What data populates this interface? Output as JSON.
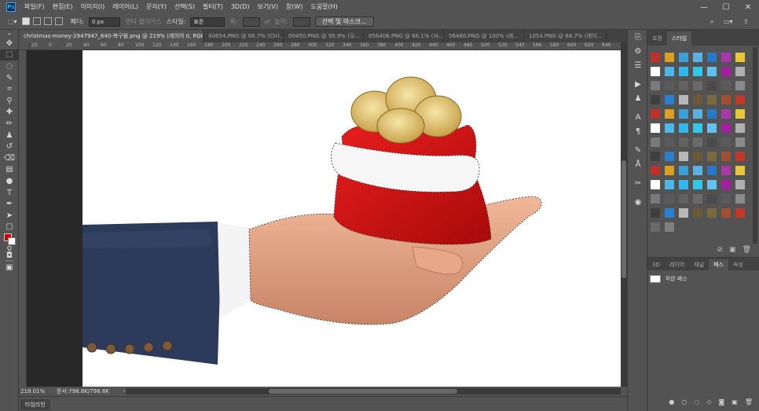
{
  "app": {
    "logo": "Ps"
  },
  "menu": [
    "파일(F)",
    "편집(E)",
    "이미지(I)",
    "레이어(L)",
    "문자(Y)",
    "선택(S)",
    "필터(T)",
    "3D(D)",
    "보기(V)",
    "창(W)",
    "도움말(H)"
  ],
  "window_controls": {
    "minimize": "—",
    "maximize": "☐",
    "close": "✕"
  },
  "options": {
    "feather_label": "페더:",
    "feather_value": "0 px",
    "antialias_label": "앤티 앨리어스",
    "style_label": "스타일:",
    "style_value": "표준",
    "width_label": "폭:",
    "height_label": "높이:",
    "select_mask_button": "선택 및 마스크..."
  },
  "tabs": [
    {
      "label": "christmas-money-2947947_640-복구됨.png @ 219% (레이어 0, RGB/8) *",
      "close": "×"
    },
    {
      "label": "40654.PNG @ 66.7% (Ctrl...",
      "close": "×"
    },
    {
      "label": "00450.PNG @ 90.9% (오...",
      "close": "×"
    },
    {
      "label": "056406.PNG @ 66.1% (사...",
      "close": "×"
    },
    {
      "label": "56460.PNG @ 100% (레...",
      "close": "×"
    },
    {
      "label": "1054.PNG @ 66.7% (레이...",
      "close": "×"
    }
  ],
  "ruler_ticks": [
    "20",
    "0",
    "20",
    "40",
    "60",
    "80",
    "100",
    "120",
    "140",
    "160",
    "180",
    "200",
    "220",
    "240",
    "260",
    "280",
    "300",
    "320",
    "340",
    "360",
    "380",
    "400",
    "420",
    "440",
    "460",
    "480",
    "500",
    "520",
    "540",
    "560",
    "580",
    "600",
    "620",
    "640"
  ],
  "status": {
    "zoom": "219.01%",
    "doc_label": "문서:798.8K/798.8K"
  },
  "timeline": {
    "label": "타임라인"
  },
  "styles_panel": {
    "tabs": [
      "조정",
      "스타일"
    ],
    "active_tab": "스타일",
    "swatches": [
      "#c03028",
      "#d8a020",
      "#3aa0d8",
      "#5ab0e0",
      "#2878c8",
      "#a838a8",
      "#e8c838",
      "#ffffff",
      "#4ab8e8",
      "#2fb8f0",
      "#2fc8e8",
      "#60c0f0",
      "#a020a0",
      "#b0b0b0",
      "#7a7a7a",
      "#5a5a5a",
      "#626262",
      "#6a6a6a",
      "#4a4a4a",
      "#5a5a5a",
      "#8a8a8a",
      "#404040",
      "#2a80d0",
      "#b8b8b8",
      "#6a5a3a",
      "#7a6a40",
      "#a05030",
      "#c03828",
      "#c03028",
      "#d8a020",
      "#3aa0d8",
      "#5ab0e0",
      "#2878c8",
      "#a838a8",
      "#e8c838",
      "#ffffff",
      "#4ab8e8",
      "#2fb8f0",
      "#2fc8e8",
      "#60c0f0",
      "#a020a0",
      "#b0b0b0",
      "#7a7a7a",
      "#5a5a5a",
      "#626262",
      "#6a6a6a",
      "#4a4a4a",
      "#5a5a5a",
      "#8a8a8a",
      "#404040",
      "#2a80d0",
      "#b8b8b8",
      "#6a5a3a",
      "#7a6a40",
      "#a05030",
      "#c03828",
      "#c03028",
      "#d8a020",
      "#3aa0d8",
      "#5ab0e0",
      "#2878c8",
      "#a838a8",
      "#e8c838",
      "#ffffff",
      "#4ab8e8",
      "#2fb8f0",
      "#2fc8e8",
      "#60c0f0",
      "#a020a0",
      "#b0b0b0",
      "#7a7a7a",
      "#5a5a5a",
      "#626262",
      "#6a6a6a",
      "#4a4a4a",
      "#5a5a5a",
      "#8a8a8a",
      "#404040",
      "#2a80d0",
      "#b8b8b8",
      "#6a5a3a",
      "#7a6a40",
      "#a05030",
      "#c03828",
      "#6a6a6a",
      "#808080"
    ]
  },
  "paths_panel": {
    "tabs": [
      "3D",
      "레이어",
      "채널",
      "패스",
      "속성"
    ],
    "active_tab": "패스",
    "paths": [
      {
        "name": "작업 패스"
      }
    ]
  },
  "colors": {
    "foreground": "#d10000",
    "background": "#ffffff",
    "accent": "#31a8ff"
  }
}
